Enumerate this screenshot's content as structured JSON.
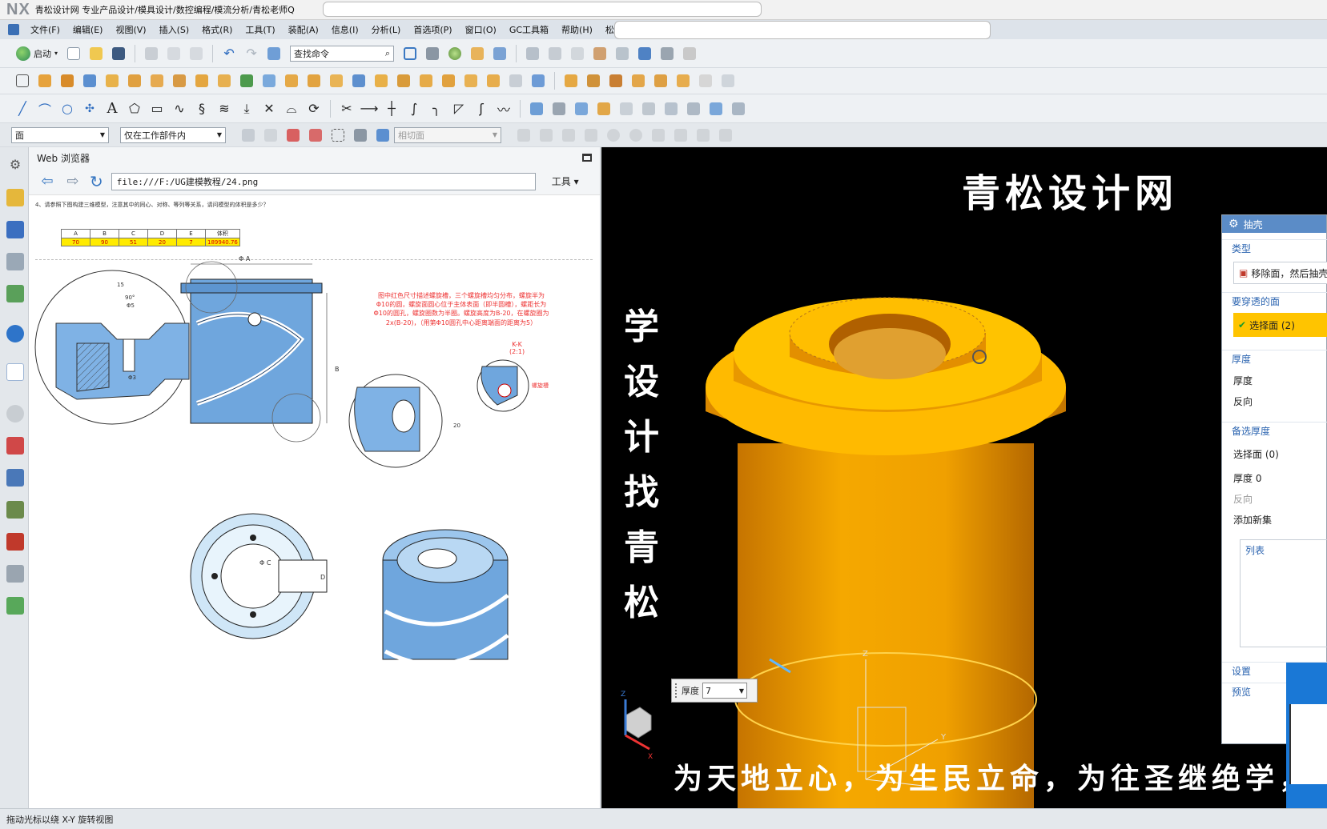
{
  "app": {
    "logo": "NX",
    "title": "青松设计网 专业产品设计/模具设计/数控编程/模流分析/青松老师Q"
  },
  "menu": [
    "文件(F)",
    "编辑(E)",
    "视图(V)",
    "插入(S)",
    "格式(R)",
    "工具(T)",
    "装配(A)",
    "信息(I)",
    "分析(L)",
    "首选项(P)",
    "窗口(O)",
    "GC工具箱",
    "帮助(H)",
    "松香教育"
  ],
  "toolbar": {
    "start_label": "启动",
    "search_placeholder": "查找命令",
    "filter_type": "面",
    "filter_scope": "仅在工作部件内",
    "snap_filter": "相切面"
  },
  "browser": {
    "title": "Web 浏览器",
    "url": "file:///F:/UG建模教程/24.png",
    "tools_label": "工具",
    "note": "4、请参照下图构建三维模型，注意其中的同心、对称、等列等关系，请问模型的体积是多少？",
    "param_headers": [
      "A",
      "B",
      "C",
      "D",
      "E",
      "体积"
    ],
    "param_values": [
      "70",
      "90",
      "51",
      "20",
      "7",
      "189940.76"
    ],
    "red_note": "图中红色尺寸描述螺旋槽，三个螺旋槽均匀分布，螺旋半为Φ10的圆，螺旋面圆心位于主体表面（即半圆槽），螺距长为Φ10的圆孔，螺旋圈数为半圈。螺旋高度为B-20，在螺旋圈为2x(B-20)，（用第Φ10圆孔中心距离端面的距离为5）",
    "section_label": "K-K\n(2:1)",
    "dimension_labels": {
      "top_dia": "Φ A",
      "det_15": "15",
      "det_90": "90°",
      "det_d5": "Φ5",
      "det_d3": "Φ3",
      "b_label": "B",
      "h_label": "20",
      "c_label": "Φ C",
      "d_label": "D",
      "spiral_label": "螺旋槽"
    }
  },
  "viewport": {
    "watermark_top": "青松设计网",
    "watermark_left": "学设计找青松",
    "watermark_bottom": "为天地立心，为生民立命，为往圣继绝学，",
    "thickness_label": "厚度",
    "thickness_value": "7",
    "axis_x": "X",
    "axis_y": "Y",
    "axis_z": "Z"
  },
  "dialog": {
    "title": "抽壳",
    "type_section": "类型",
    "type_value": "移除面，然后抽壳",
    "pierce_section": "要穿透的面",
    "select_face": "选择面 (2)",
    "thickness_section": "厚度",
    "thickness_label": "厚度",
    "reverse_label": "反向",
    "alt_section": "备选厚度",
    "alt_select": "选择面 (0)",
    "alt_thickness": "厚度 0",
    "alt_reverse": "反向",
    "add_set": "添加新集",
    "list_label": "列表",
    "settings_section": "设置",
    "preview_section": "预览"
  },
  "status": "拖动光标以绕 X-Y 旋转视图",
  "colors": {
    "part_orange": "#f5a800",
    "selection_yellow": "#ffc400",
    "drawing_blue": "#6fa6dd",
    "dialog_header": "#5b8cc7"
  }
}
